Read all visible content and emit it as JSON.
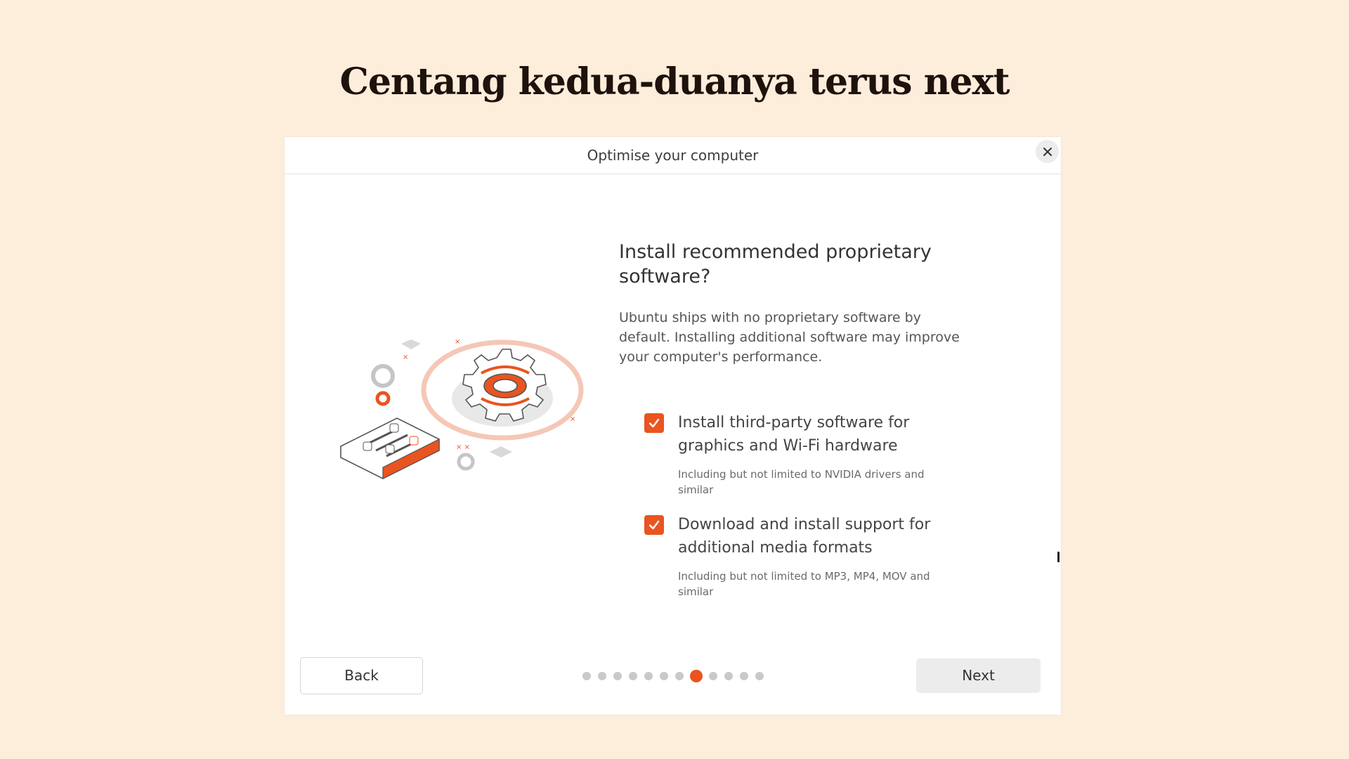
{
  "slide": {
    "title": "Centang kedua-duanya terus next"
  },
  "dialog": {
    "title": "Optimise your computer",
    "heading": "Install recommended proprietary software?",
    "description": "Ubuntu ships with no proprietary software by default. Installing additional software may improve your computer's performance.",
    "options": [
      {
        "label": "Install third-party software for graphics and Wi-Fi hardware",
        "sublabel": "Including but not limited to NVIDIA drivers and similar",
        "checked": true
      },
      {
        "label": "Download and install support for additional media formats",
        "sublabel": "Including but not limited to MP3, MP4, MOV and similar",
        "checked": true
      }
    ],
    "back_label": "Back",
    "next_label": "Next",
    "progress": {
      "total_steps": 12,
      "current_step": 8
    }
  },
  "colors": {
    "background": "#fdeddb",
    "accent": "#e95420",
    "dot_inactive": "#c9c9c9"
  },
  "icons": {
    "close": "close-icon",
    "check": "checkmark-icon",
    "illustration": "gear-settings-illustration"
  }
}
